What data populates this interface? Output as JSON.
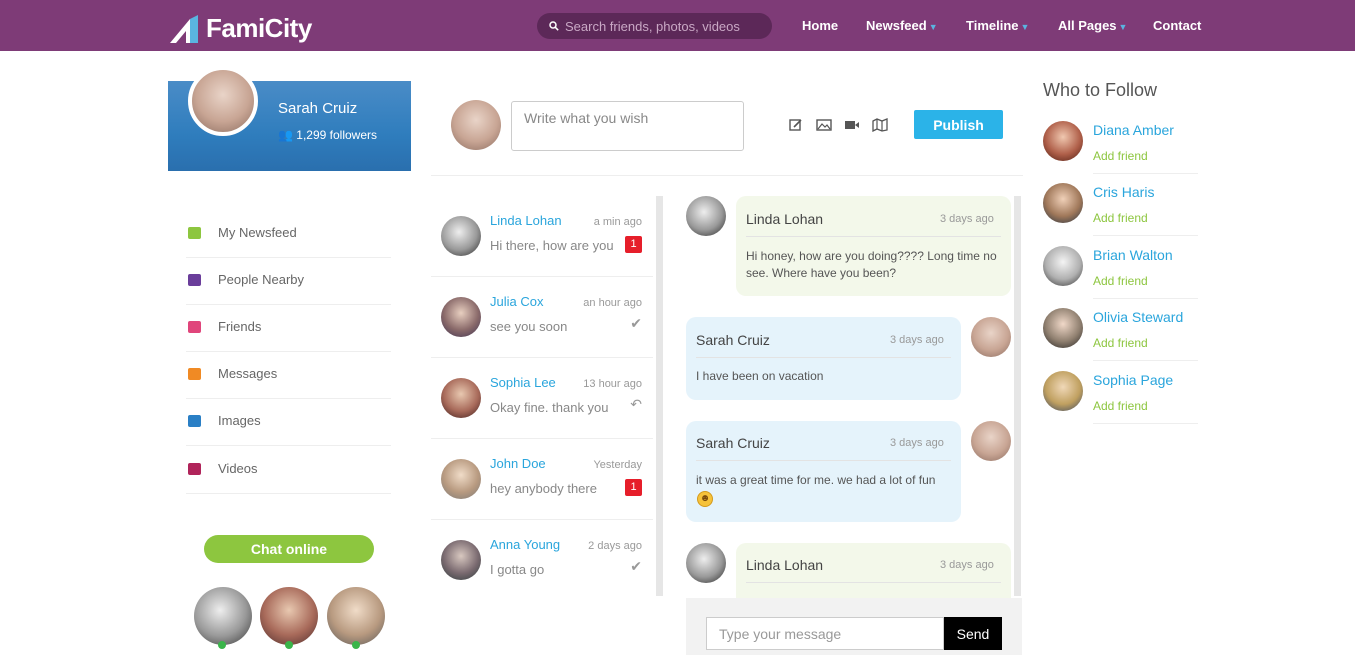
{
  "brand": {
    "name": "FamiCity"
  },
  "search": {
    "placeholder": "Search friends, photos, videos"
  },
  "nav": [
    {
      "label": "Home",
      "dropdown": false
    },
    {
      "label": "Newsfeed",
      "dropdown": true
    },
    {
      "label": "Timeline",
      "dropdown": true
    },
    {
      "label": "All Pages",
      "dropdown": true
    },
    {
      "label": "Contact",
      "dropdown": false
    }
  ],
  "profile": {
    "name": "Sarah Cruiz",
    "followers": "1,299 followers"
  },
  "sidebar": [
    {
      "label": "My Newsfeed",
      "icon": "newsfeed-icon",
      "color": "#8dc63f"
    },
    {
      "label": "People Nearby",
      "icon": "people-icon",
      "color": "#6a3d9a"
    },
    {
      "label": "Friends",
      "icon": "friends-icon",
      "color": "#e0457b"
    },
    {
      "label": "Messages",
      "icon": "messages-icon",
      "color": "#f08a24"
    },
    {
      "label": "Images",
      "icon": "images-icon",
      "color": "#2a7fc5"
    },
    {
      "label": "Videos",
      "icon": "videos-icon",
      "color": "#b0245a"
    }
  ],
  "chat_online": {
    "label": "Chat online"
  },
  "post": {
    "placeholder": "Write what you wish",
    "publish_label": "Publish"
  },
  "conversations": [
    {
      "name": "Linda Lohan",
      "time": "a min ago",
      "message": "Hi there, how are you",
      "badge": "1",
      "status_icon": ""
    },
    {
      "name": "Julia Cox",
      "time": "an hour ago",
      "message": "see you soon",
      "badge": "",
      "status_icon": "check-icon"
    },
    {
      "name": "Sophia Lee",
      "time": "13 hour ago",
      "message": "Okay fine. thank you",
      "badge": "",
      "status_icon": "reply-icon"
    },
    {
      "name": "John Doe",
      "time": "Yesterday",
      "message": "hey anybody there",
      "badge": "1",
      "status_icon": ""
    },
    {
      "name": "Anna Young",
      "time": "2 days ago",
      "message": "I gotta go",
      "badge": "",
      "status_icon": "check-icon"
    }
  ],
  "messages": [
    {
      "name": "Linda Lohan",
      "time": "3 days ago",
      "text": "Hi honey, how are you doing???? Long time no see. Where have you been?"
    },
    {
      "name": "Sarah Cruiz",
      "time": "3 days ago",
      "text": "I have been on vacation"
    },
    {
      "name": "Sarah Cruiz",
      "time": "3 days ago",
      "text": "it was a great time for me. we had a lot of fun"
    },
    {
      "name": "Linda Lohan",
      "time": "3 days ago",
      "text": ""
    }
  ],
  "composer": {
    "placeholder": "Type your message",
    "send_label": "Send"
  },
  "who_to_follow": {
    "title": "Who to Follow",
    "people": [
      {
        "name": "Diana Amber",
        "action": "Add friend"
      },
      {
        "name": "Cris Haris",
        "action": "Add friend"
      },
      {
        "name": "Brian Walton",
        "action": "Add friend"
      },
      {
        "name": "Olivia Steward",
        "action": "Add friend"
      },
      {
        "name": "Sophia Page",
        "action": "Add friend"
      }
    ]
  },
  "colors": {
    "topbar": "#7e3b77",
    "accent_blue": "#2aa5dc",
    "accent_green": "#8dc63f",
    "badge_red": "#e61e2a"
  }
}
